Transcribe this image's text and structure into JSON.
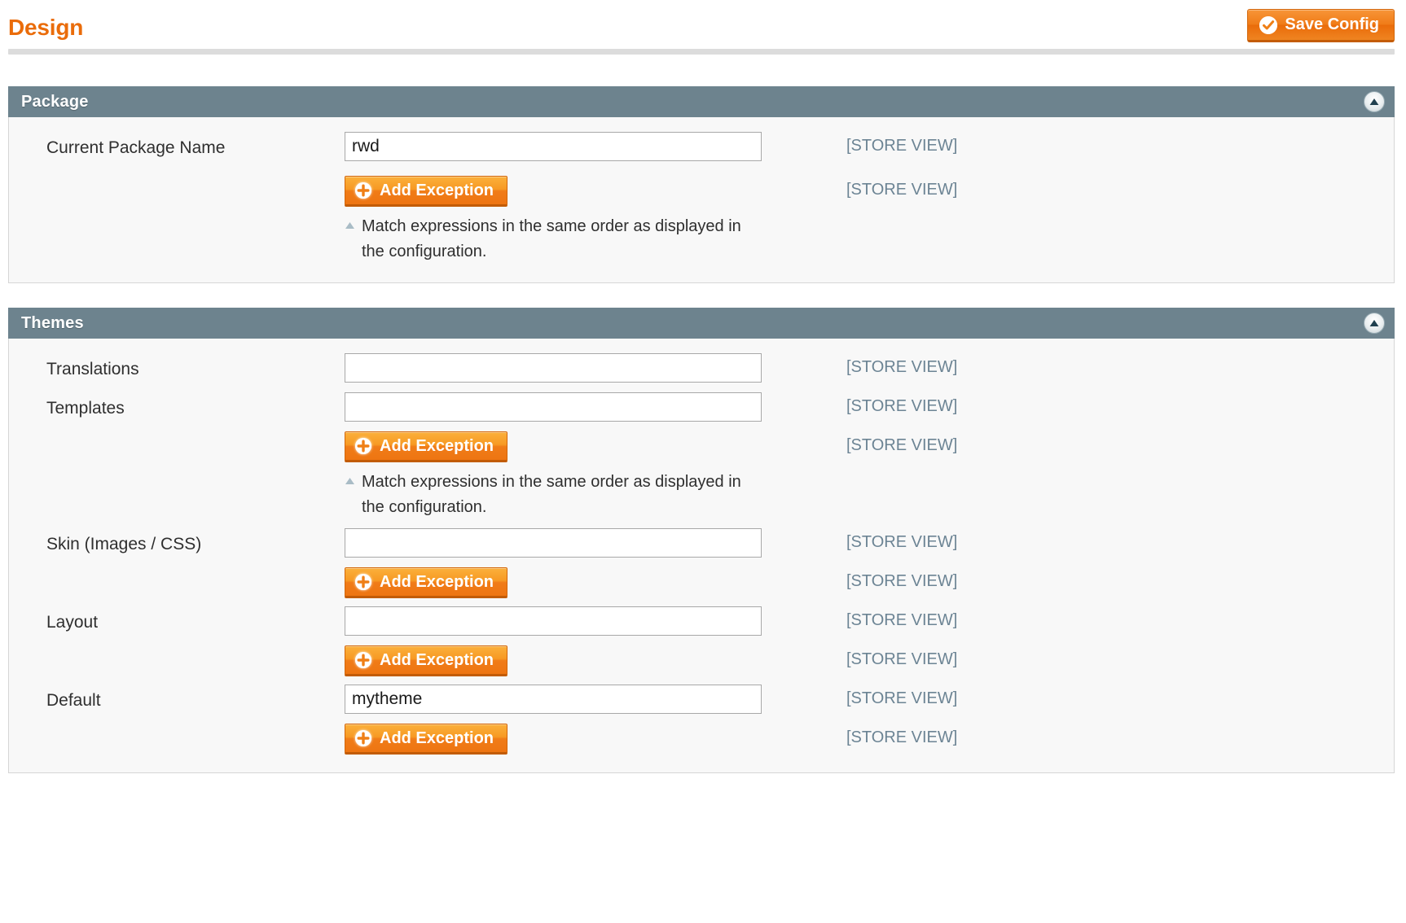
{
  "header": {
    "title": "Design",
    "save_label": "Save Config",
    "save_icon": "check-circle-icon"
  },
  "sections": [
    {
      "id": "package",
      "title": "Package",
      "collapse_icon": "triangle-up-icon",
      "rows": [
        {
          "label": "Current Package Name",
          "type": "text",
          "value": "rwd",
          "scope": "[STORE VIEW]"
        },
        {
          "label": "",
          "type": "button",
          "button_label": "Add Exception",
          "button_icon": "plus-circle-icon",
          "hint": "Match expressions in the same order as displayed in the configuration.",
          "hint_icon": "triangle-up-small-icon",
          "scope": "[STORE VIEW]"
        }
      ]
    },
    {
      "id": "themes",
      "title": "Themes",
      "collapse_icon": "triangle-up-icon",
      "rows": [
        {
          "label": "Translations",
          "type": "text",
          "value": "",
          "scope": "[STORE VIEW]"
        },
        {
          "label": "Templates",
          "type": "text",
          "value": "",
          "scope": "[STORE VIEW]"
        },
        {
          "label": "",
          "type": "button",
          "button_label": "Add Exception",
          "button_icon": "plus-circle-icon",
          "hint": "Match expressions in the same order as displayed in the configuration.",
          "hint_icon": "triangle-up-small-icon",
          "scope": "[STORE VIEW]"
        },
        {
          "label": "Skin (Images / CSS)",
          "type": "text",
          "value": "",
          "scope": "[STORE VIEW]"
        },
        {
          "label": "",
          "type": "button",
          "button_label": "Add Exception",
          "button_icon": "plus-circle-icon",
          "hint": "",
          "scope": "[STORE VIEW]"
        },
        {
          "label": "Layout",
          "type": "text",
          "value": "",
          "scope": "[STORE VIEW]"
        },
        {
          "label": "",
          "type": "button",
          "button_label": "Add Exception",
          "button_icon": "plus-circle-icon",
          "hint": "",
          "scope": "[STORE VIEW]"
        },
        {
          "label": "Default",
          "type": "text",
          "value": "mytheme",
          "scope": "[STORE VIEW]"
        },
        {
          "label": "",
          "type": "button",
          "button_label": "Add Exception",
          "button_icon": "plus-circle-icon",
          "hint": "",
          "scope": "[STORE VIEW]"
        }
      ]
    }
  ],
  "colors": {
    "accent_orange": "#ea6c0a",
    "section_header": "#6d838e",
    "scope_label": "#6c8494",
    "panel_bg": "#f8f8f8"
  }
}
